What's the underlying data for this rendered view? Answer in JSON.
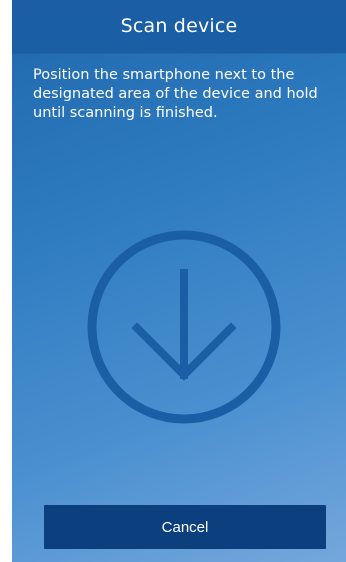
{
  "header": {
    "title": "Scan device"
  },
  "instructions": {
    "text": "Position the smartphone next to the designated area of the device and hold until scanning is finished."
  },
  "scan_indicator": {
    "icon": "arrow-down-circle-icon",
    "color": "#1a5ea6"
  },
  "footer": {
    "cancel_label": "Cancel"
  },
  "colors": {
    "header_bg": "#1b5ea6",
    "button_bg": "#0b3f7e",
    "text": "#ffffff"
  }
}
